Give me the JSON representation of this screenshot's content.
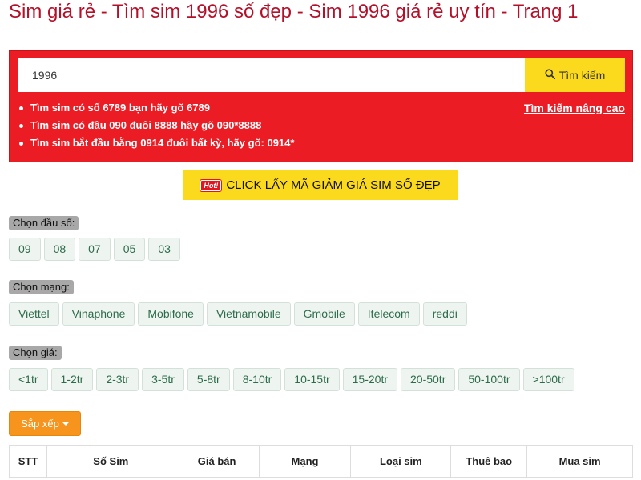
{
  "page": {
    "title": "Sim giá rẻ - Tìm sim 1996 số đẹp - Sim 1996 giá rẻ uy tín - Trang 1"
  },
  "search": {
    "value": "1996",
    "button_label": "Tìm kiếm",
    "advanced_link": "Tìm kiếm nâng cao",
    "tips": [
      {
        "a": "Tìm sim có số ",
        "b": "6789",
        "c": " bạn hãy gõ ",
        "d": "6789"
      },
      {
        "a": "Tìm sim có đầu ",
        "b": "090",
        "c": " đuôi ",
        "d": "8888",
        "e": " hãy gõ ",
        "f": "090*8888"
      },
      {
        "a": "Tìm sim bắt đầu bằng ",
        "b": "0914",
        "c": " đuôi bất kỳ, hãy gõ: ",
        "d": "0914*"
      }
    ]
  },
  "promo": {
    "badge": "Hot!",
    "label": "CLICK LẤY MÃ GIẢM GIÁ SIM SỐ ĐẸP"
  },
  "filters": {
    "prefix": {
      "label": "Chọn đầu số:",
      "options": [
        "09",
        "08",
        "07",
        "05",
        "03"
      ]
    },
    "network": {
      "label": "Chọn mạng:",
      "options": [
        "Viettel",
        "Vinaphone",
        "Mobifone",
        "Vietnamobile",
        "Gmobile",
        "Itelecom",
        "reddi"
      ]
    },
    "price": {
      "label": "Chọn giá:",
      "options": [
        "<1tr",
        "1-2tr",
        "2-3tr",
        "3-5tr",
        "5-8tr",
        "8-10tr",
        "10-15tr",
        "15-20tr",
        "20-50tr",
        "50-100tr",
        ">100tr"
      ]
    }
  },
  "sort": {
    "label": "Sắp xếp"
  },
  "table": {
    "headers": [
      "STT",
      "Số Sim",
      "Giá bán",
      "Mạng",
      "Loại sim",
      "Thuê bao",
      "Mua sim"
    ]
  },
  "colors": {
    "title": "#b3112a",
    "search_bg": "#ec1c24",
    "accent_yellow": "#fbd91c",
    "sort_orange": "#f7941d",
    "chip_text": "#2e6b4a"
  }
}
